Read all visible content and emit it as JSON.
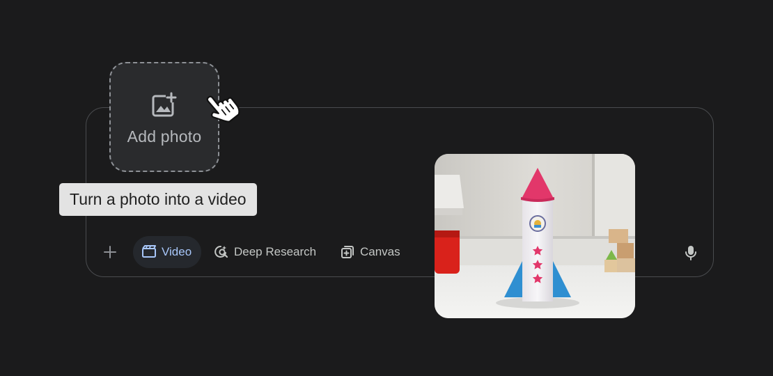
{
  "add_photo": {
    "label": "Add photo",
    "icon": "add-photo-icon"
  },
  "tooltip": {
    "text": "Turn a photo into a video"
  },
  "toolbar": {
    "add_icon": "plus-icon",
    "tools": [
      {
        "label": "Video",
        "icon": "clapperboard-icon",
        "active": true
      },
      {
        "label": "Deep Research",
        "icon": "deep-research-icon",
        "active": false
      },
      {
        "label": "Canvas",
        "icon": "canvas-icon",
        "active": false
      }
    ],
    "mic_icon": "microphone-icon"
  },
  "colors": {
    "background": "#1b1b1c",
    "accent": "#a8c7fa",
    "text": "#c4c7c5",
    "tooltip_bg": "#e3e3e3"
  }
}
